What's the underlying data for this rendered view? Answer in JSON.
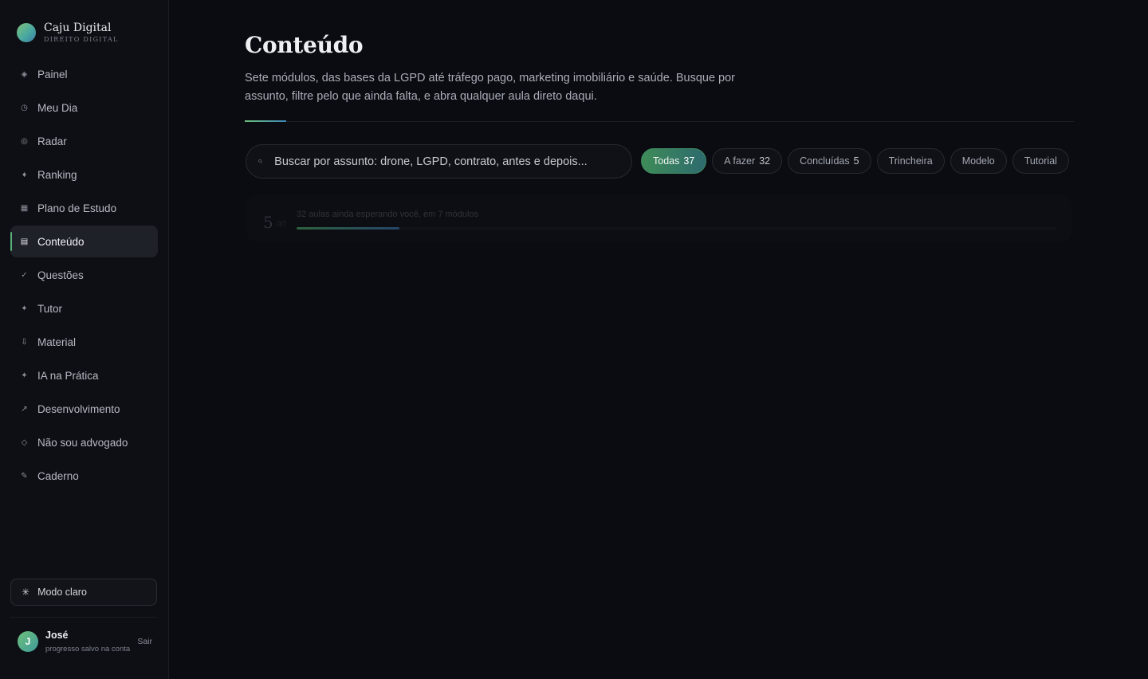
{
  "brand": {
    "name": "Caju Digital",
    "subtitle": "DIREITO DIGITAL"
  },
  "sidebar": {
    "items": [
      {
        "label": "Painel",
        "icon": "diamond-icon"
      },
      {
        "label": "Meu Dia",
        "icon": "clock-icon"
      },
      {
        "label": "Radar",
        "icon": "radar-icon"
      },
      {
        "label": "Ranking",
        "icon": "trophy-icon"
      },
      {
        "label": "Plano de Estudo",
        "icon": "grid-icon"
      },
      {
        "label": "Conteúdo",
        "icon": "list-icon",
        "active": true
      },
      {
        "label": "Questões",
        "icon": "check-icon"
      },
      {
        "label": "Tutor",
        "icon": "sparkle-icon"
      },
      {
        "label": "Material",
        "icon": "download-icon"
      },
      {
        "label": "IA na Prática",
        "icon": "sparkle-icon"
      },
      {
        "label": "Desenvolvimento",
        "icon": "arrow-up-right-icon"
      },
      {
        "label": "Não sou advogado",
        "icon": "diamond-outline-icon"
      },
      {
        "label": "Caderno",
        "icon": "pencil-icon"
      }
    ],
    "mode_toggle": "Modo claro"
  },
  "user": {
    "initial": "J",
    "name": "José",
    "status": "progresso salvo na conta",
    "logout": "Sair"
  },
  "main": {
    "title": "Conteúdo",
    "description": "Sete módulos, das bases da LGPD até tráfego pago, marketing imobiliário e saúde. Busque por assunto, filtre pelo que ainda falta, e abra qualquer aula direto daqui.",
    "search_placeholder": "Buscar por assunto: drone, LGPD, contrato, antes e depois...",
    "filters": [
      {
        "label": "Todas",
        "count": "37",
        "active": true
      },
      {
        "label": "A fazer",
        "count": "32"
      },
      {
        "label": "Concluídas",
        "count": "5"
      },
      {
        "label": "Trincheira",
        "count": ""
      },
      {
        "label": "Modelo",
        "count": ""
      },
      {
        "label": "Tutorial",
        "count": ""
      }
    ],
    "progress": {
      "completed": "5",
      "total": "/37",
      "label": "32 aulas ainda esperando você, em 7 módulos",
      "fraction": 0.1351
    }
  },
  "colors": {
    "accent_green": "#59b07a",
    "accent_blue": "#3f86b8",
    "background": "#0b0c11"
  }
}
